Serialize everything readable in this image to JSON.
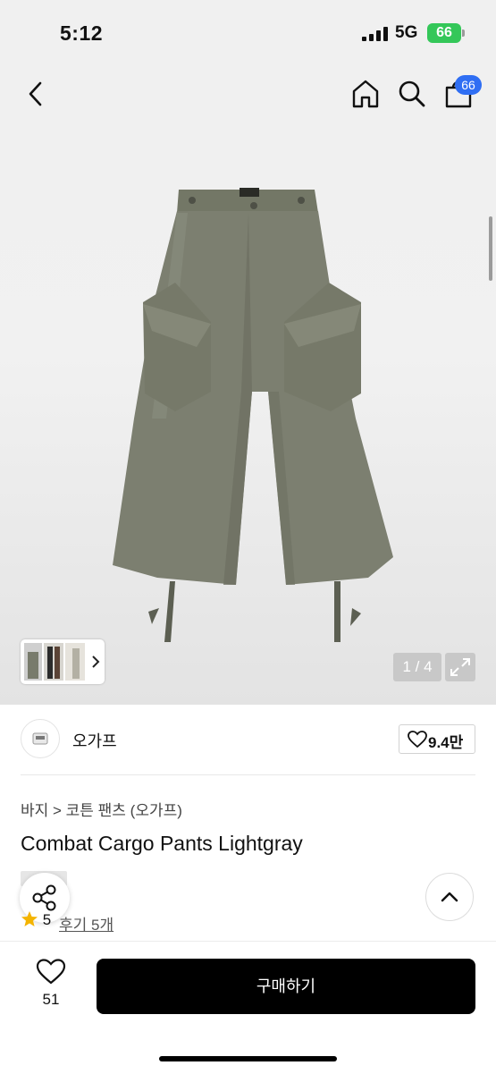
{
  "status_bar": {
    "time": "5:12",
    "network": "5G",
    "battery": "66"
  },
  "header": {
    "cart_badge": "66"
  },
  "gallery": {
    "page_indicator": "1 / 4"
  },
  "store": {
    "name": "오가프",
    "likes": "9.4만"
  },
  "product": {
    "breadcrumb": "바지 > 코튼 팬츠 (오가프)",
    "title": "Combat Cargo Pants Lightgray",
    "rating": "5",
    "review_link": "후기 5개"
  },
  "bottom": {
    "wish_count": "51",
    "buy_label": "구매하기"
  },
  "colors": {
    "accent": "#2f6ef3",
    "buy_button": "#000000",
    "battery": "#34c759",
    "star": "#f4b400"
  }
}
